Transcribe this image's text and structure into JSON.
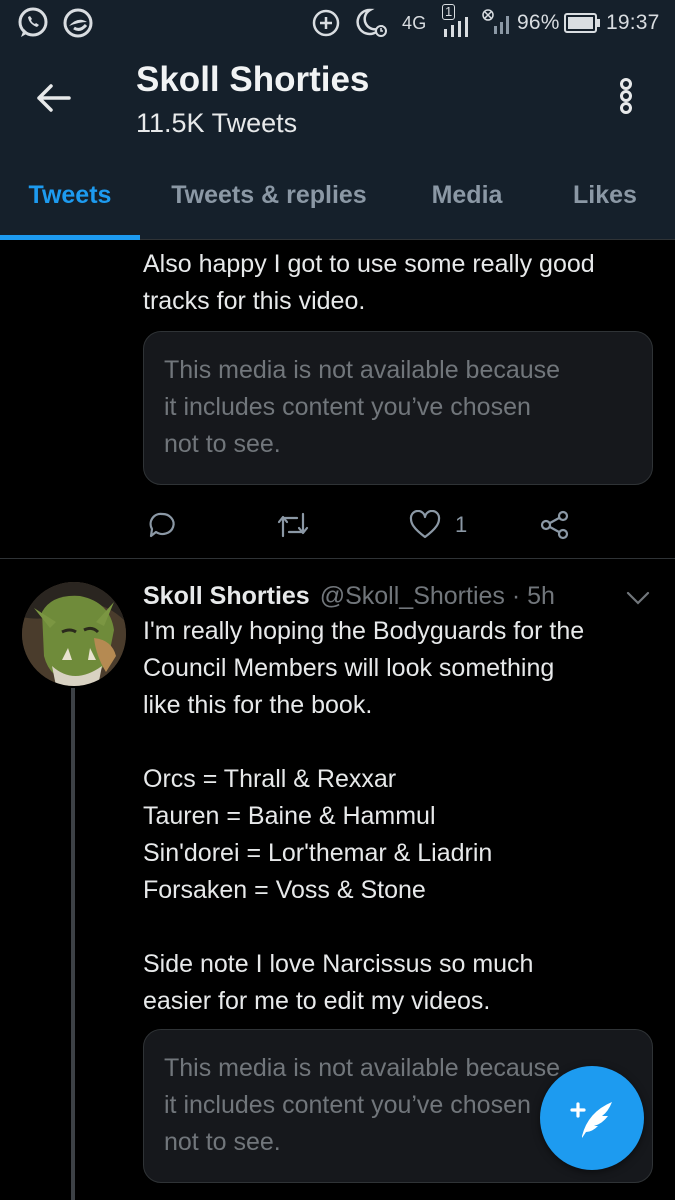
{
  "status_bar": {
    "network": "4G",
    "sim": "1",
    "battery": "96%",
    "time": "19:37",
    "icons": [
      "whatsapp-icon",
      "vpn-icon",
      "add-circle-icon",
      "dnd-moon-icon",
      "signal-icon",
      "no-signal-icon",
      "battery-icon"
    ]
  },
  "header": {
    "title": "Skoll Shorties",
    "subtitle": "11.5K Tweets"
  },
  "tabs": [
    {
      "label": "Tweets",
      "active": true
    },
    {
      "label": "Tweets & replies",
      "active": false
    },
    {
      "label": "Media",
      "active": false
    },
    {
      "label": "Likes",
      "active": false
    }
  ],
  "tweets": [
    {
      "text": "Also happy I got to use some really good\ntracks for this video.",
      "media_notice": "This media is not available because\nit includes content you’ve chosen\nnot to see.",
      "likes": "1"
    },
    {
      "name": "Skoll Shorties",
      "handle": "@Skoll_Shorties · 5h",
      "text": "I'm really hoping the Bodyguards for the\nCouncil Members will look something\nlike this for the book.\n\nOrcs = Thrall & Rexxar\nTauren = Baine & Hammul\nSin'dorei = Lor'themar & Liadrin\nForsaken = Voss & Stone\n\nSide note I love Narcissus so much\neasier for me to edit my videos.",
      "media_notice": "This media is not available because\nit includes content you’ve chosen\nnot to see."
    }
  ],
  "colors": {
    "accent": "#1d9bf0",
    "header_bg": "#15202b",
    "background": "#000000"
  }
}
